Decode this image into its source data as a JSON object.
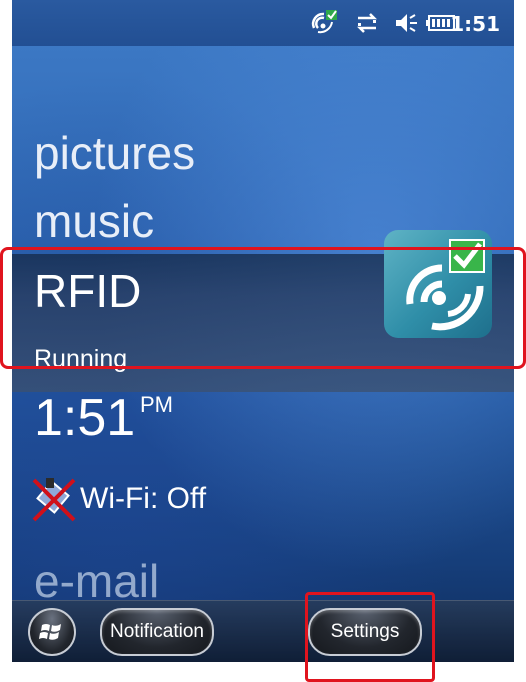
{
  "status_bar": {
    "rfid_icon": "rfid-signal-icon",
    "sync_icon": "sync-arrows-icon",
    "volume_icon": "volume-icon",
    "battery_icon": "battery-icon",
    "time": "1:51"
  },
  "home": {
    "items": [
      {
        "label": "pictures"
      },
      {
        "label": "music"
      }
    ],
    "rfid": {
      "title": "RFID",
      "status": "Running",
      "icon": "rfid-app-icon"
    },
    "clock": {
      "time": "1:51",
      "ampm": "PM"
    },
    "wifi": {
      "label": "Wi-Fi: Off",
      "icon": "wifi-off-icon"
    },
    "email": {
      "label": "e-mail"
    }
  },
  "taskbar": {
    "start_icon": "windows-start-icon",
    "notification_label": "Notification",
    "settings_label": "Settings"
  },
  "colors": {
    "highlight": "#e0141e",
    "background_top": "#3f7cc8",
    "background_bottom": "#0e2c5c"
  }
}
